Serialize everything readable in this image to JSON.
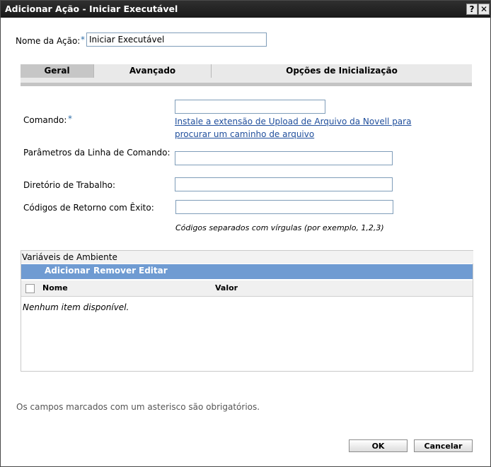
{
  "dialog": {
    "title": "Adicionar Ação - Iniciar Executável",
    "help_label": "?",
    "close_label": "✕"
  },
  "action_name": {
    "label": "Nome da Ação:",
    "required_mark": "*",
    "value": "Iniciar Executável"
  },
  "tabs": [
    {
      "label": "Geral",
      "active": true
    },
    {
      "label": "Avançado",
      "active": false
    },
    {
      "label": "Opções de Inicialização",
      "active": false
    }
  ],
  "command": {
    "label": "Comando:",
    "required_mark": "*",
    "value": "",
    "link_line1": "Instale a extensão de Upload de Arquivo da Novell para",
    "link_line2": "procurar um caminho de arquivo"
  },
  "params": {
    "label": "Parâmetros da Linha de Comando:",
    "value": ""
  },
  "workdir": {
    "label": "Diretório de Trabalho:",
    "value": ""
  },
  "return_codes": {
    "label": "Códigos de Retorno com Êxito:",
    "value": "",
    "hint": "Códigos separados com vírgulas (por exemplo, 1,2,3)"
  },
  "env_vars": {
    "title": "Variáveis de Ambiente",
    "toolbar": {
      "add": "Adicionar",
      "remove": "Remover",
      "edit": "Editar"
    },
    "columns": {
      "name": "Nome",
      "value": "Valor"
    },
    "empty_text": "Nenhum item disponível."
  },
  "footnote": "Os campos marcados com um asterisco são obrigatórios.",
  "buttons": {
    "ok": "OK",
    "cancel": "Cancelar"
  }
}
